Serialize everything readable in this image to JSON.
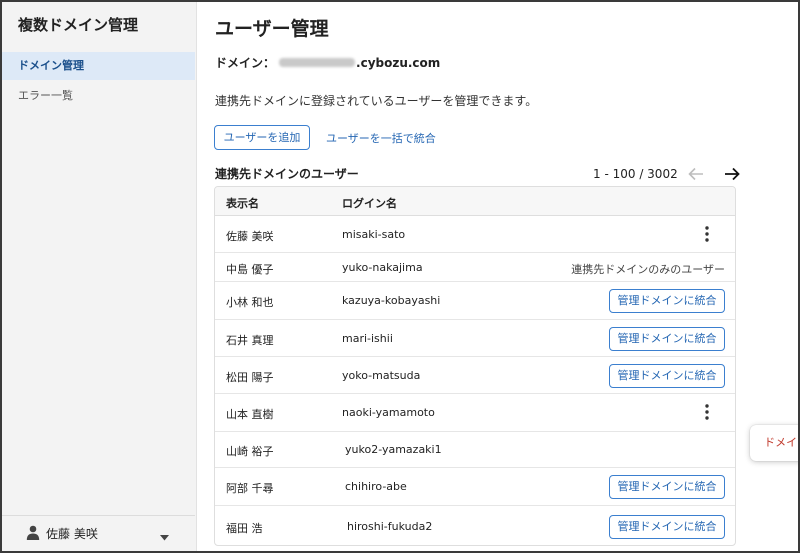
{
  "sidebar": {
    "app_title": "複数ドメイン管理",
    "items": [
      {
        "label": "ドメイン管理",
        "active": true
      },
      {
        "label": "エラー一覧",
        "active": false
      }
    ],
    "user": {
      "name": "佐藤 美咲"
    }
  },
  "main": {
    "title": "ユーザー管理",
    "domain_prefix": "ドメイン：",
    "domain_suffix": ".cybozu.com",
    "description": "連携先ドメインに登録されているユーザーを管理できます。",
    "add_user_button": "ユーザーを追加",
    "bulk_merge_link": "ユーザーを一括で統合",
    "section_title": "連携先ドメインのユーザー",
    "pagination": "1 - 100 / 3002",
    "table": {
      "headers": [
        "表示名",
        "ログイン名"
      ],
      "merge_label": "管理ドメインに統合",
      "rows": [
        {
          "name": "佐藤 美咲",
          "login": "misaki-sato",
          "action": "menu"
        },
        {
          "name": "中島 優子",
          "login": "yuko-nakajima",
          "action": "note",
          "note": "連携先ドメインのみのユーザー"
        },
        {
          "name": "小林 和也",
          "login": "kazuya-kobayashi",
          "action": "merge"
        },
        {
          "name": "石井 真理",
          "login": "mari-ishii",
          "action": "merge"
        },
        {
          "name": "松田 陽子",
          "login": "yoko-matsuda",
          "action": "merge"
        },
        {
          "name": "山本 直樹",
          "login": "naoki-yamamoto",
          "action": "menu"
        },
        {
          "name": "山崎 裕子",
          "login": "yuko2-yamazaki1",
          "action": "none"
        },
        {
          "name": "阿部 千尋",
          "login": "chihiro-abe",
          "action": "merge"
        },
        {
          "name": "福田 浩",
          "login": "hiroshi-fukuda2",
          "action": "merge"
        }
      ]
    },
    "popup": {
      "label": "ドメインからユーザーを削除"
    }
  },
  "colors": {
    "accent": "#2466b3",
    "danger": "#c0392b",
    "sidebar_bg": "#f3f3f3",
    "active_bg": "#dde9f7"
  },
  "icons": {
    "user": "person-icon",
    "dropdown": "caret-down-icon",
    "prev": "arrow-left-icon",
    "next": "arrow-right-icon",
    "menu": "kebab-menu-icon"
  }
}
